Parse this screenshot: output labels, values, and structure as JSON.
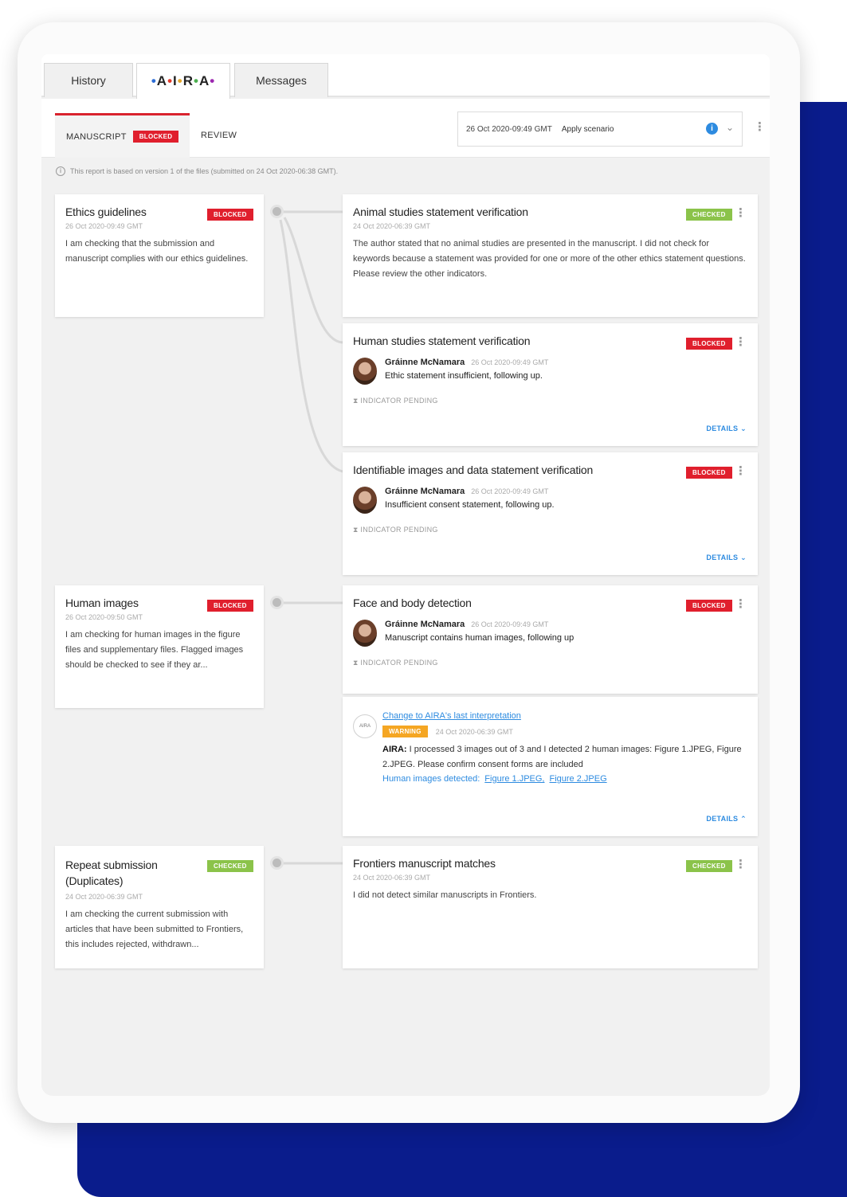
{
  "tabs": {
    "history": "History",
    "aira": [
      "A",
      "I",
      "R",
      "A"
    ],
    "messages": "Messages"
  },
  "subtabs": {
    "manuscript": "MANUSCRIPT",
    "manuscript_badge": "BLOCKED",
    "review": "REVIEW"
  },
  "scenario": {
    "timestamp": "26 Oct 2020-09:49 GMT",
    "label": "Apply scenario",
    "info_count": "i"
  },
  "notice": "This report is based on version 1 of the files (submitted on 24 Oct 2020-06:38 GMT).",
  "groups": [
    {
      "title": "Ethics guidelines",
      "badge": "BLOCKED",
      "date": "26 Oct 2020-09:49 GMT",
      "desc": "I am checking that the submission and manuscript complies with our ethics guidelines."
    },
    {
      "title": "Human images",
      "badge": "BLOCKED",
      "date": "26 Oct 2020-09:50 GMT",
      "desc": "I am checking for human images in the figure files and supplementary files. Flagged images should be checked to see if they ar..."
    },
    {
      "title": "Repeat submission (Duplicates)",
      "badge": "CHECKED",
      "date": "24 Oct 2020-06:39 GMT",
      "desc": "I am checking the current submission with articles that have been submitted to Frontiers, this includes rejected, withdrawn..."
    }
  ],
  "checks": {
    "animal": {
      "title": "Animal studies statement verification",
      "badge": "CHECKED",
      "date": "24 Oct 2020-06:39 GMT",
      "desc": "The author stated that no animal studies are presented in the manuscript. I did not check for keywords because a statement was provided for one or more of the other ethics statement questions. Please review the other indicators."
    },
    "human": {
      "title": "Human studies statement verification",
      "badge": "BLOCKED",
      "author": "Gráinne McNamara",
      "date": "26 Oct 2020-09:49 GMT",
      "text": "Ethic statement insufficient, following up.",
      "pending": "INDICATOR PENDING",
      "details": "DETAILS"
    },
    "identifiable": {
      "title": "Identifiable images and data statement verification",
      "badge": "BLOCKED",
      "author": "Gráinne McNamara",
      "date": "26 Oct 2020-09:49 GMT",
      "text": "Insufficient consent statement, following up.",
      "pending": "INDICATOR PENDING",
      "details": "DETAILS"
    },
    "face": {
      "title": "Face and body detection",
      "badge": "BLOCKED",
      "author": "Gráinne McNamara",
      "date": "26 Oct 2020-09:49 GMT",
      "text": "Manuscript contains human images, following up",
      "pending": "INDICATOR PENDING"
    },
    "aira_note": {
      "avatar": "AIRA",
      "link": "Change to AIRA's last interpretation",
      "badge": "WARNING",
      "date": "24 Oct 2020-06:39 GMT",
      "author": "AIRA:",
      "text": "I processed 3 images out of 3 and I detected 2 human images: Figure 1.JPEG, Figure 2.JPEG. Please confirm consent forms are included",
      "detected_label": "Human images detected:",
      "fig1": "Figure 1.JPEG,",
      "fig2": "Figure 2.JPEG",
      "details": "DETAILS"
    },
    "frontiers": {
      "title": "Frontiers manuscript matches",
      "badge": "CHECKED",
      "date": "24 Oct 2020-06:39 GMT",
      "desc": "I did not detect similar manuscripts in Frontiers."
    }
  },
  "colors": {
    "blocked": "#e01f2d",
    "checked": "#8bc34a",
    "warning": "#f5a623",
    "link": "#2d8be0",
    "backdrop": "#0a1c8c"
  }
}
